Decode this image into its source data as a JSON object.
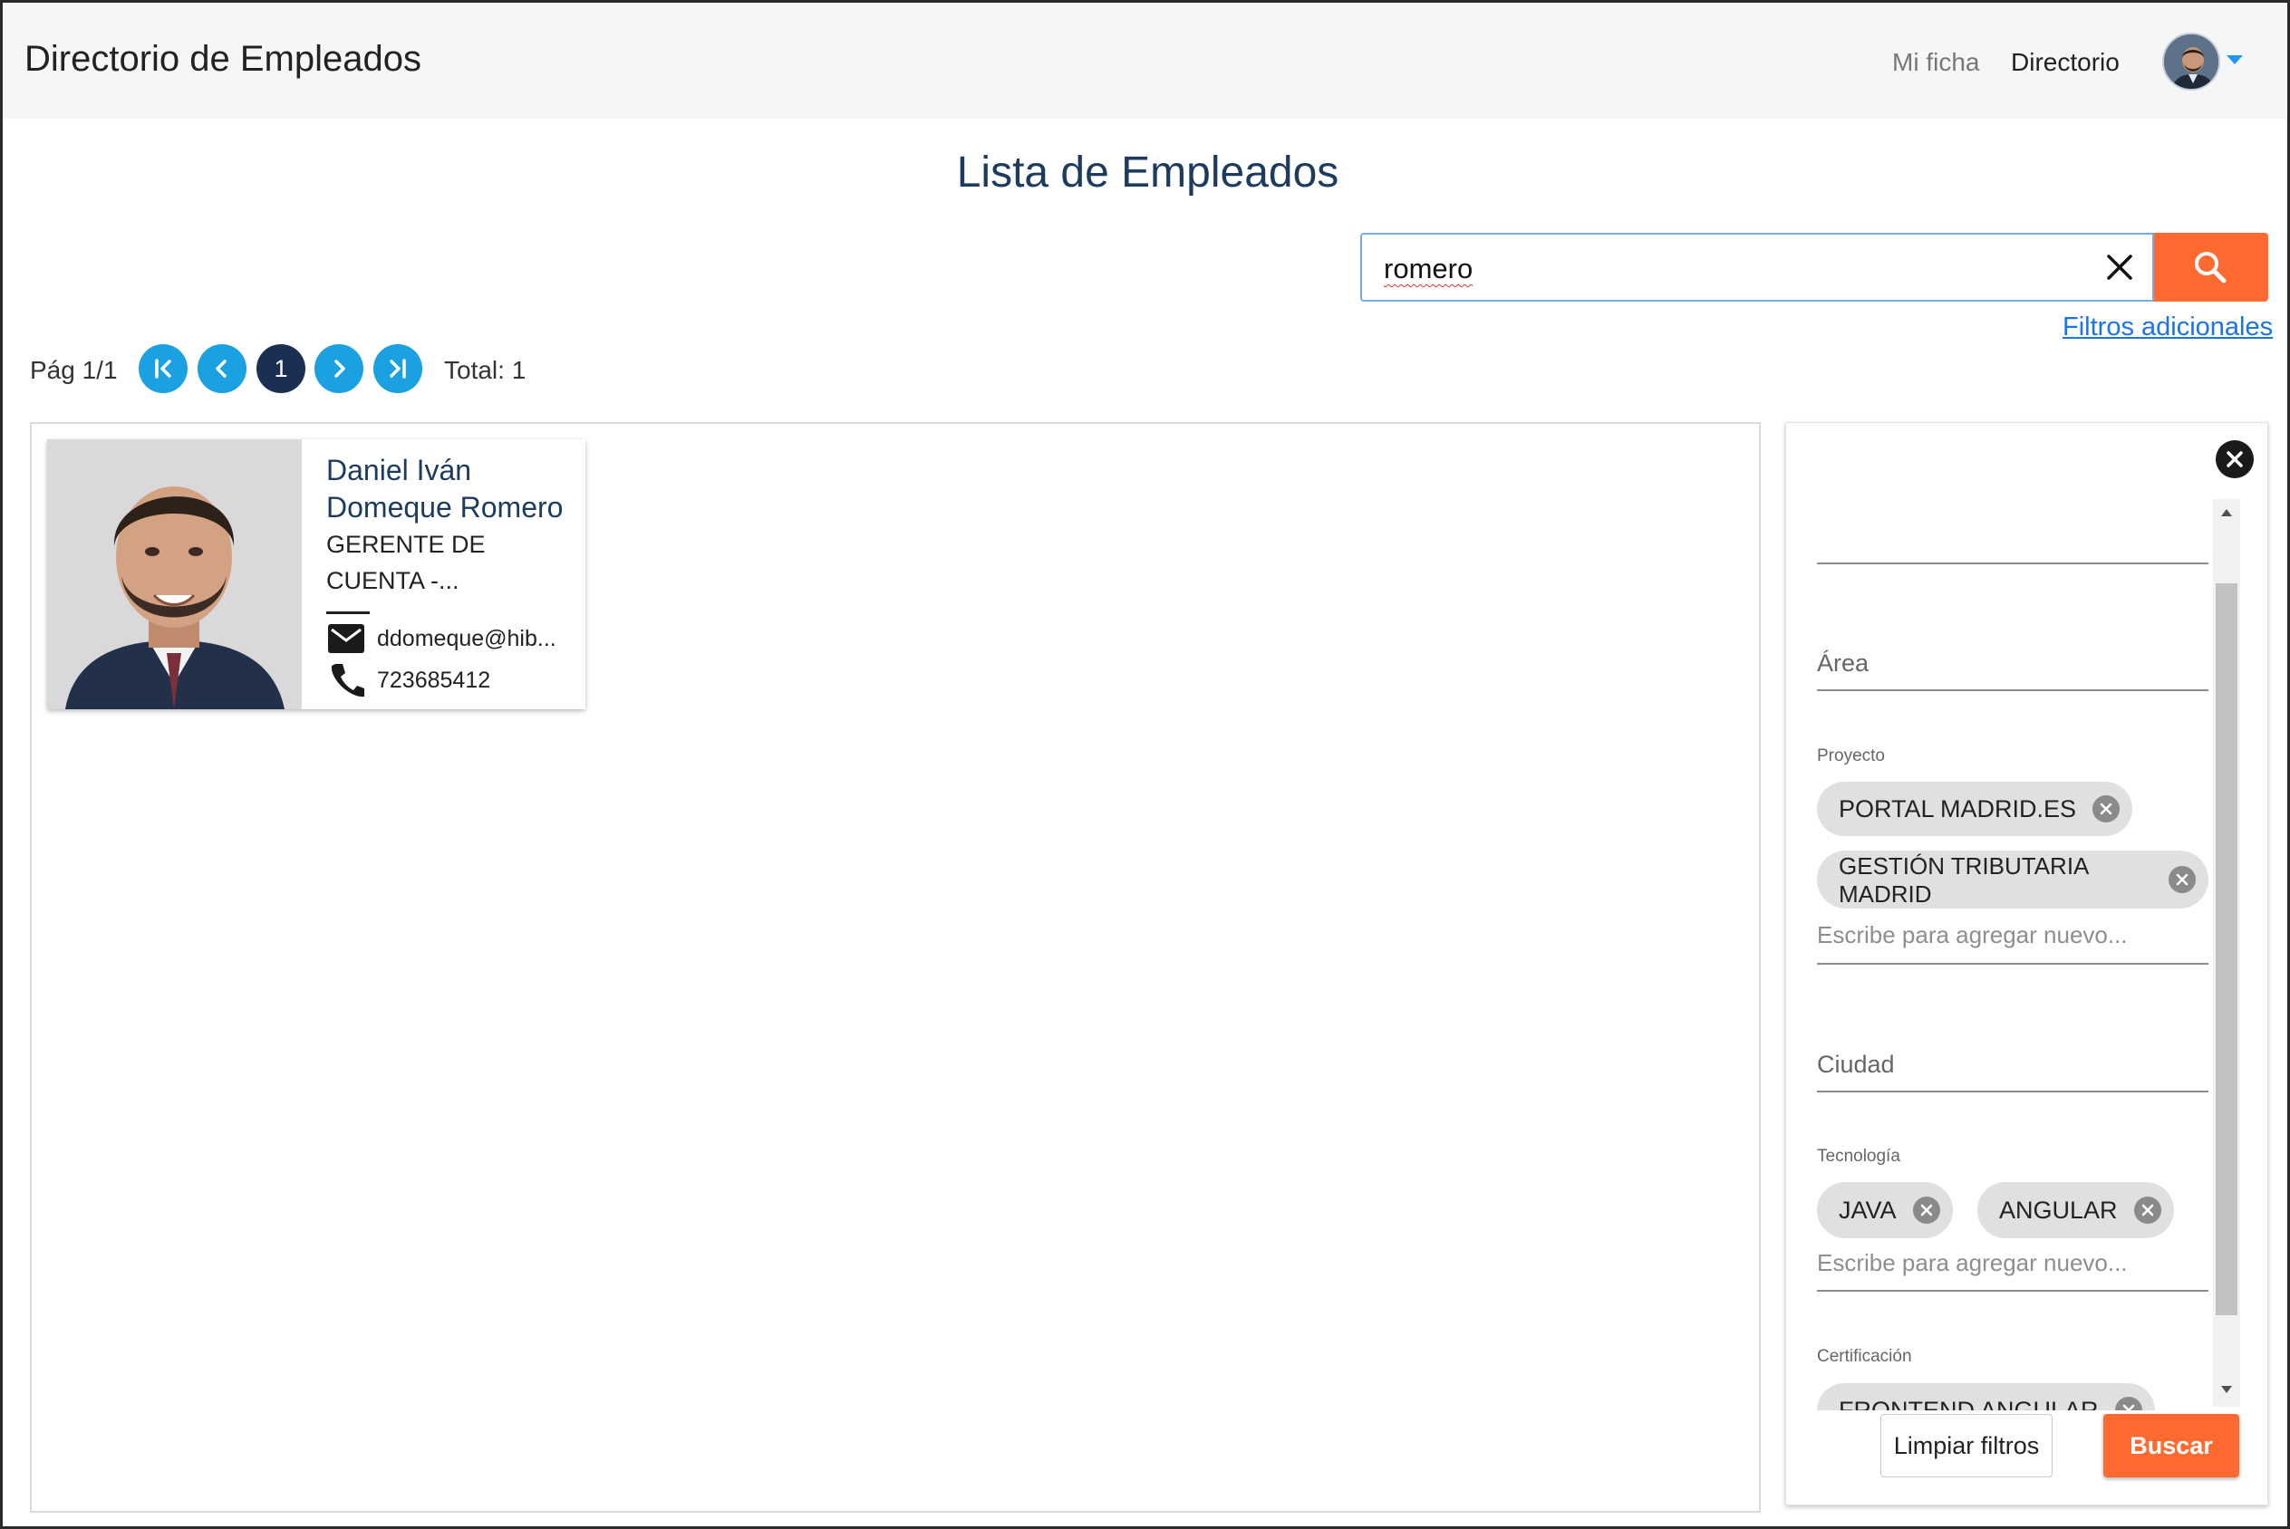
{
  "header": {
    "title": "Directorio de Empleados",
    "nav": {
      "mi_ficha": "Mi ficha",
      "directorio": "Directorio"
    },
    "avatar_icon": "user-avatar",
    "accent_color": "#2196f3"
  },
  "page": {
    "title": "Lista de Empleados"
  },
  "search": {
    "value": "romero",
    "clear_icon": "close-icon",
    "button_icon": "search-icon",
    "button_color": "#ff6a30",
    "filters_link": "Filtros adicionales"
  },
  "pagination": {
    "page_label": "Pág 1/1",
    "current_page": "1",
    "total_label": "Total: 1",
    "button_color": "#1ba0e2",
    "current_color": "#1b2f52"
  },
  "employees": [
    {
      "name": "Daniel Iván Domeque Romero",
      "role": "GERENTE DE CUENTA -...",
      "email": "ddomeque@hib...",
      "phone": "723685412"
    }
  ],
  "filters": {
    "area_label": "Área",
    "proyecto": {
      "label": "Proyecto",
      "chips": [
        "PORTAL MADRID.ES",
        "GESTIÓN TRIBUTARIA MADRID"
      ],
      "input_placeholder": "Escribe para agregar nuevo..."
    },
    "ciudad_label": "Ciudad",
    "tecnologia": {
      "label": "Tecnología",
      "chips": [
        "JAVA",
        "ANGULAR"
      ],
      "input_placeholder": "Escribe para agregar nuevo..."
    },
    "certificacion": {
      "label": "Certificación",
      "chips": [
        "FRONTEND ANGULAR"
      ]
    },
    "clear_button": "Limpiar filtros",
    "search_button": "Buscar"
  }
}
